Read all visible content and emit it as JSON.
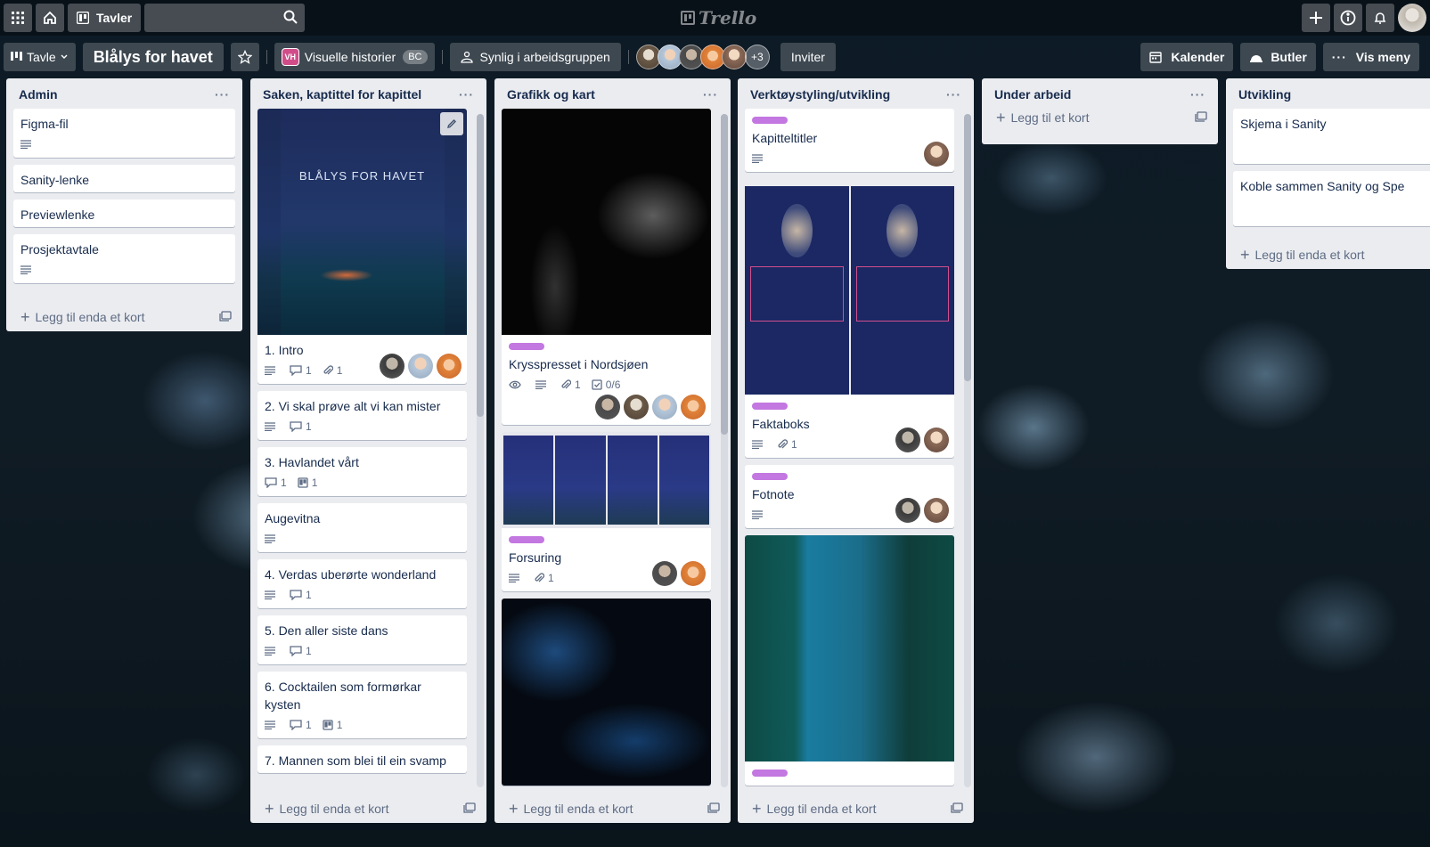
{
  "topbar": {
    "boards_label": "Tavler",
    "search_placeholder": "",
    "logo": "Trello"
  },
  "board": {
    "view_label": "Tavle",
    "title": "Blålys for havet",
    "workspace_badge": "VH",
    "workspace": "Visuelle historier",
    "workspace_tag": "BC",
    "visibility": "Synlig i arbeidsgruppen",
    "members_more": "+3",
    "invite": "Inviter",
    "calendar": "Kalender",
    "butler": "Butler",
    "menu": "Vis meny"
  },
  "colors": {
    "label_purple": "#c377e0",
    "list_bg": "#ebecf0"
  },
  "lists": [
    {
      "title": "Admin",
      "add": "Legg til enda et kort",
      "cards": [
        {
          "title": "Figma-fil"
        },
        {
          "title": "Sanity-lenke"
        },
        {
          "title": "Previewlenke"
        },
        {
          "title": "Prosjektavtale"
        }
      ]
    },
    {
      "title": "Saken, kaptittel for kapittel",
      "add": "Legg til enda et kort",
      "cover_title": "BLÅLYS FOR HAVET",
      "cards": [
        {
          "title": "1. Intro",
          "comments": "1",
          "attachments": "1"
        },
        {
          "title": "2. Vi skal prøve alt vi kan mister",
          "comments": "1"
        },
        {
          "title": "3. Havlandet vårt",
          "comments": "1",
          "boards": "1"
        },
        {
          "title": "Augevitna"
        },
        {
          "title": "4. Verdas uberørte wonderland",
          "comments": "1"
        },
        {
          "title": "5. Den aller siste dans",
          "comments": "1"
        },
        {
          "title": "6. Cocktailen som formørkar kysten",
          "comments": "1",
          "boards": "1"
        },
        {
          "title": "7. Mannen som blei til ein svamp"
        }
      ]
    },
    {
      "title": "Grafikk og kart",
      "add": "Legg til enda et kort",
      "cards": [
        {
          "title": "Krysspresset i Nordsjøen",
          "attachments": "1",
          "checklist": "0/6"
        },
        {
          "title": "Forsuring",
          "attachments": "1"
        }
      ]
    },
    {
      "title": "Verktøystyling/utvikling",
      "add": "Legg til enda et kort",
      "cards": [
        {
          "title": "Kapitteltitler"
        },
        {
          "title": "Faktaboks",
          "attachments": "1"
        },
        {
          "title": "Fotnote"
        }
      ]
    },
    {
      "title": "Under arbeid",
      "add": "Legg til et kort"
    },
    {
      "title": "Utvikling",
      "add": "Legg til enda et kort",
      "cards": [
        {
          "title": "Skjema i Sanity"
        },
        {
          "title": "Koble sammen Sanity og Spe"
        }
      ]
    }
  ]
}
